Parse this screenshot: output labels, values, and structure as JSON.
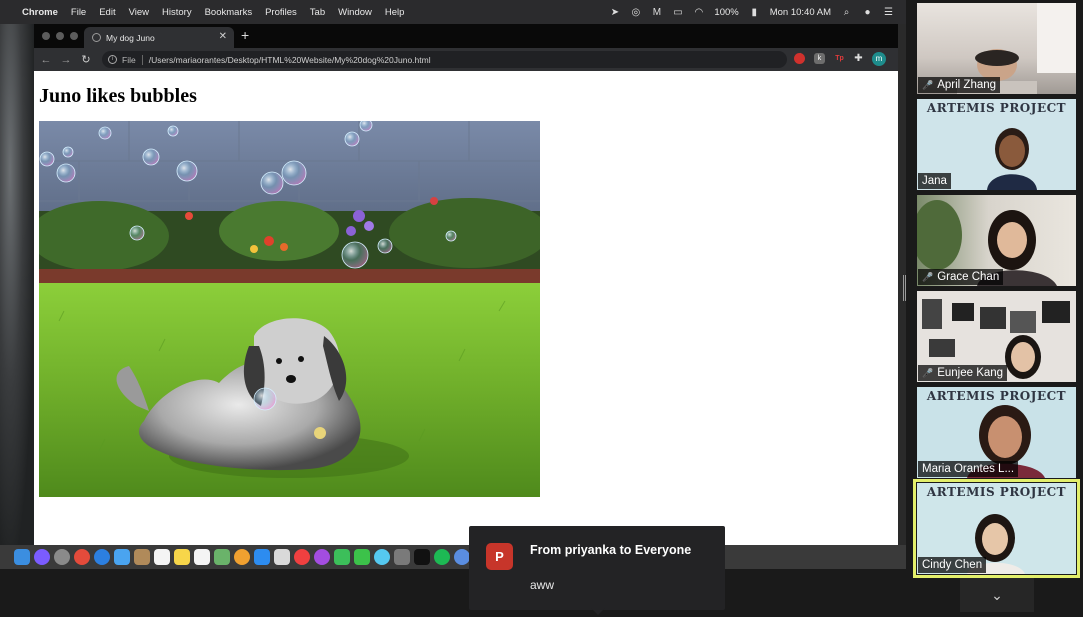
{
  "menubar": {
    "app": "Chrome",
    "items": [
      "File",
      "Edit",
      "View",
      "History",
      "Bookmarks",
      "Profiles",
      "Tab",
      "Window",
      "Help"
    ],
    "battery": "100%",
    "clock": "Mon 10:40 AM"
  },
  "browser": {
    "tab_title": "My dog Juno",
    "url_scheme": "File",
    "url": "/Users/mariaorantes/Desktop/HTML%20Website/My%20dog%20Juno.html",
    "profile_initial": "m"
  },
  "page": {
    "heading": "Juno likes bubbles"
  },
  "notification": {
    "avatar_initial": "P",
    "from": "From priyanka to Everyone",
    "message": "aww"
  },
  "participants": [
    {
      "name": "April Zhang",
      "muted": true
    },
    {
      "name": "Jana",
      "muted": false,
      "banner": "ARTEMIS PROJECT"
    },
    {
      "name": "Grace Chan",
      "muted": true
    },
    {
      "name": "Eunjee Kang",
      "muted": true
    },
    {
      "name": "Maria Orantes L...",
      "muted": false,
      "banner": "ARTEMIS PROJECT"
    },
    {
      "name": "Cindy Chen",
      "muted": false,
      "banner": "ARTEMIS PROJECT",
      "active": true
    }
  ],
  "colors": {
    "active_speaker": "#e3ef6b",
    "muted": "#ff3b30",
    "profile": "#1e8c8c",
    "avatar": "#c7352a"
  }
}
